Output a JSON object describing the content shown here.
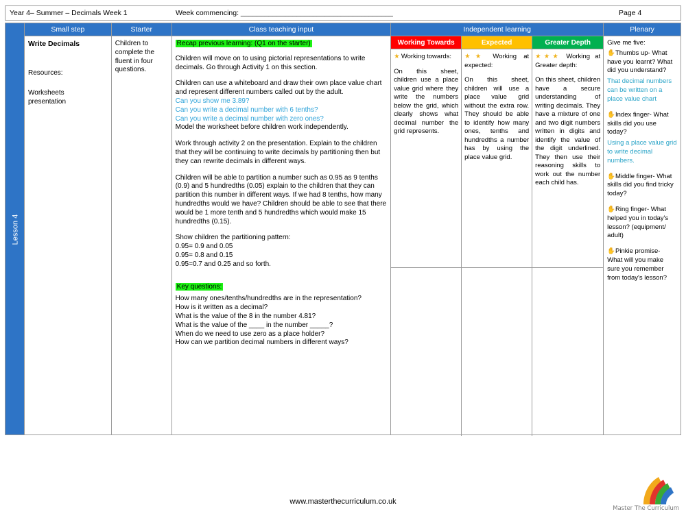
{
  "header": {
    "left": "Year 4– Summer – Decimals Week 1",
    "middle": "Week commencing: ______________________________________",
    "right": "Page 4"
  },
  "lesson_label": "Lesson 4",
  "columns": {
    "small_step": "Small step",
    "starter": "Starter",
    "class_teaching": "Class teaching input",
    "independent": "Independent learning",
    "plenary": "Plenary"
  },
  "small_step": {
    "title": "Write Decimals",
    "resources_label": "Resources:",
    "resources": "Worksheets\npresentation"
  },
  "starter": {
    "text": "Children to complete the fluent in four questions."
  },
  "class_teaching": {
    "recap_heading": "Recap previous learning: (Q1 on the starter)",
    "p1": "Children will move on to using pictorial representations to write decimals. Go through Activity 1 on this section.",
    "p2": "Children can use a whiteboard and draw their own place value chart and represent different numbers called out by the adult.",
    "q1": "Can you show me 3.89?",
    "q2": "Can you write a decimal number with 6 tenths?",
    "q3": "Can you write a decimal number with zero ones?",
    "p3": "Model the worksheet before children work independently.",
    "p4": "Work through activity 2 on the presentation. Explain to the children that they will be continuing to write decimals by partitioning then but they can rewrite decimals in different ways.",
    "p5": "Children will be able to partition a number such as 0.95 as 9 tenths (0.9) and 5 hundredths (0.05) explain to the children that they can partition this number in different ways. If we had 8 tenths, how many hundredths would we have? Children should be able to see that there would be 1 more tenth and 5 hundredths which would make 15 hundredths (0.15).",
    "pattern_intro": "Show children the partitioning pattern:",
    "pattern1": "0.95= 0.9 and 0.05",
    "pattern2": "0.95= 0.8 and 0.15",
    "pattern3": "0.95=0.7 and 0.25 and so forth.",
    "key_questions_heading": "Key questions:",
    "kq1": "How many ones/tenths/hundredths are in the representation?",
    "kq2": "How is it written as a decimal?",
    "kq3": "What is the value of the 8 in the number 4.81?",
    "kq4": "What is the value of the ____ in the number _____?",
    "kq5": "When do we need to use zero as a place holder?",
    "kq6": "How can we partition decimal numbers in different ways?"
  },
  "independent": {
    "groups": [
      {
        "label": "Working Towards",
        "color": "#ff0000",
        "stars": "★",
        "heading": "Working towards:",
        "text": "On this sheet, children use a place value  grid where they write the numbers below  the grid, which clearly shows what  decimal number the grid represents."
      },
      {
        "label": "Expected",
        "color": "#ffc000",
        "stars": "★★",
        "heading": "Working at expected:",
        "text": "On this sheet, children will use a place   value grid without the extra row. They should be able to identify how many ones,  tenths and hundredths a number has by  using the place value grid."
      },
      {
        "label": "Greater Depth",
        "color": "#00b050",
        "stars": "★★★",
        "heading": "Working at Greater depth:",
        "text": "On this sheet, children have a  secure understanding of writing decimals. They  have a mixture of one and two digit  numbers written in digits and identify the value of the digit underlined. They then  use their reasoning skills to work out the  number each child has."
      }
    ]
  },
  "plenary": {
    "intro": "Give me five:",
    "thumbs_icon": "✋",
    "thumbs": "Thumbs up- What have you learnt? What did you understand?",
    "thumbs_answer": "That decimal numbers can be written on a place value chart",
    "index": "Index finger- What skills did you use today?",
    "index_answer": "Using a place value grid to write decimal numbers.",
    "middle": "Middle finger- What skills did you find tricky today?",
    "ring": "Ring finger- What helped you in today's lesson? (equipment/ adult)",
    "pinkie": "Pinkie promise- What will you make sure you remember from today's lesson?"
  },
  "footer": {
    "url": "www.masterthecurriculum.co.uk",
    "logo_text": "Master  The  Curriculum"
  }
}
